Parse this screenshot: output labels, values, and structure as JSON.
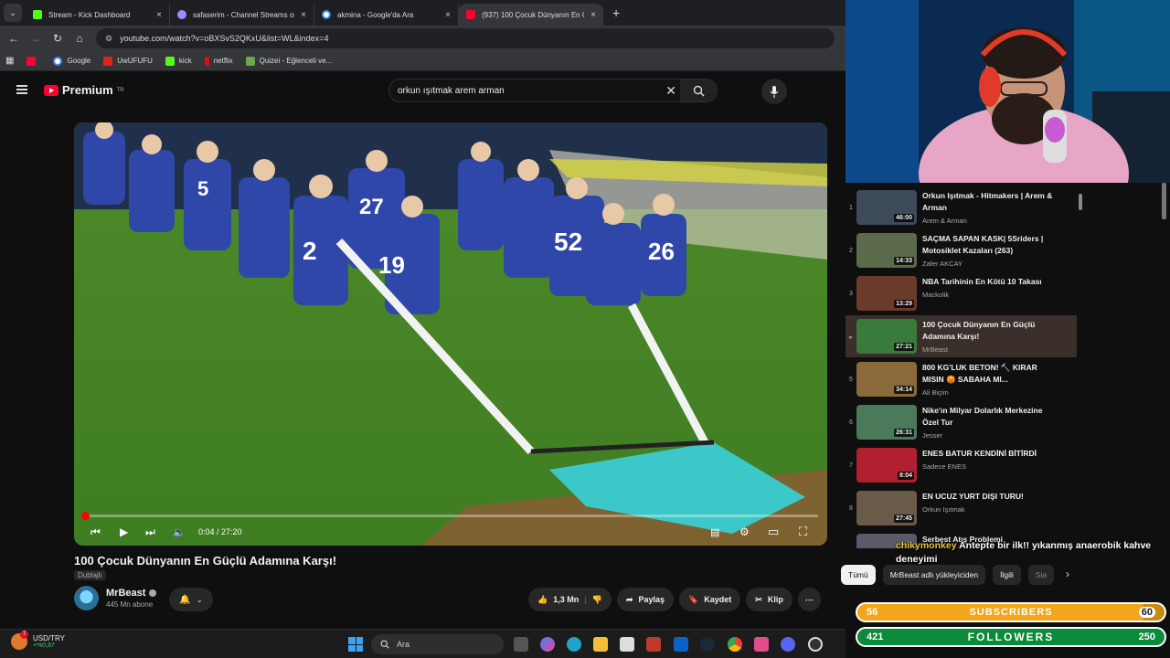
{
  "browser": {
    "tabs": [
      {
        "label": "Stream - Kick Dashboard",
        "color": "#53fc18",
        "active": false
      },
      {
        "label": "safaserim - Channel Streams on",
        "color": "#9b8cff",
        "active": false
      },
      {
        "label": "akmina - Google'da Ara",
        "color": "#4285f4",
        "active": false
      },
      {
        "label": "(937) 100 Çocuk Dünyanın En G",
        "color": "#ff0033",
        "active": true
      }
    ],
    "url": "youtube.com/watch?v=oBXSvS2QKxU&list=WL&index=4",
    "bookmarks": [
      {
        "label": "",
        "color": "#ff0033"
      },
      {
        "label": "Google",
        "color": "#4285f4"
      },
      {
        "label": "UwUFUFU",
        "color": "#e2231a"
      },
      {
        "label": "kick",
        "color": "#53fc18"
      },
      {
        "label": "netflix",
        "color": "#e50914"
      },
      {
        "label": "Quizei - Eğlenceli ve...",
        "color": "#6aa84f"
      }
    ]
  },
  "youtube": {
    "logo_text": "Premium",
    "logo_sup": "TR",
    "search_value": "orkun ışıtmak arem arman",
    "player": {
      "time": "0:04 / 27:20",
      "progress": 0.0024
    },
    "video_title": "100 Çocuk Dünyanın En Güçlü Adamına Karşı!",
    "dubbed_label": "Dublajlı",
    "channel_name": "MrBeast",
    "subscribers": "445 Mn abone",
    "actions": {
      "likes": "1,3 Mn",
      "share": "Paylaş",
      "save": "Kaydet",
      "clip": "Klip"
    },
    "playlist": [
      {
        "index": "1",
        "title": "Orkun Işıtmak - Hitmakers | Arem & Arman",
        "channel": "Arem & Arman",
        "duration": "46:00",
        "thumb": "#3c4a5a"
      },
      {
        "index": "2",
        "title": "SAÇMA SAPAN KASK| 5Sriders | Motosiklet Kazaları (263)",
        "channel": "Zafer AKCAY",
        "duration": "14:33",
        "thumb": "#5a6a4a"
      },
      {
        "index": "3",
        "title": "NBA Tarihinin En Kötü 10 Takası",
        "channel": "Mackolik",
        "duration": "13:29",
        "thumb": "#6a3a2a"
      },
      {
        "index": "▸",
        "title": "100 Çocuk Dünyanın En Güçlü Adamına Karşı!",
        "channel": "MrBeast",
        "duration": "27:21",
        "thumb": "#3a7a3a",
        "active": true
      },
      {
        "index": "5",
        "title": "800 KG'LUK BETON! 🔨 KIRAR MISIN 😡 SABAHA MI...",
        "channel": "Ali Biçim",
        "duration": "34:14",
        "thumb": "#8a6a3a"
      },
      {
        "index": "6",
        "title": "Nike'ın Milyar Dolarlık Merkezine Özel Tur",
        "channel": "Jesser",
        "duration": "26:31",
        "thumb": "#4a7a5a"
      },
      {
        "index": "7",
        "title": "ENES BATUR KENDİNİ BİTİRDİ",
        "channel": "Sadece ENES",
        "duration": "8:04",
        "thumb": "#b02030"
      },
      {
        "index": "8",
        "title": "EN UCUZ YURT DIŞI TURU!",
        "channel": "Orkun Işıtmak",
        "duration": "27:45",
        "thumb": "#6a5a4a"
      },
      {
        "index": "9",
        "title": "Serbest Atış Problemi",
        "channel": "",
        "duration": "",
        "thumb": "#5a5a6a"
      }
    ],
    "chips": [
      "Tümü",
      "MrBeast adlı yükleyiciden",
      "İlgili",
      "Sia"
    ]
  },
  "overlay": {
    "chat_user": "chikymonkey",
    "chat_message": "Antepte bir ilk!! yıkanmış anaerobik kahve deneyimi",
    "subs_left": "56",
    "subs_label": "SUBSCRIBERS",
    "subs_right": "60",
    "subs_progress": 0.93,
    "followers_left": "421",
    "followers_label": "FOLLOWERS",
    "followers_right": "250"
  },
  "taskbar": {
    "ticker": "USD/TRY",
    "change": "+%0,87",
    "search_placeholder": "Ara",
    "weather_badge": "7"
  }
}
